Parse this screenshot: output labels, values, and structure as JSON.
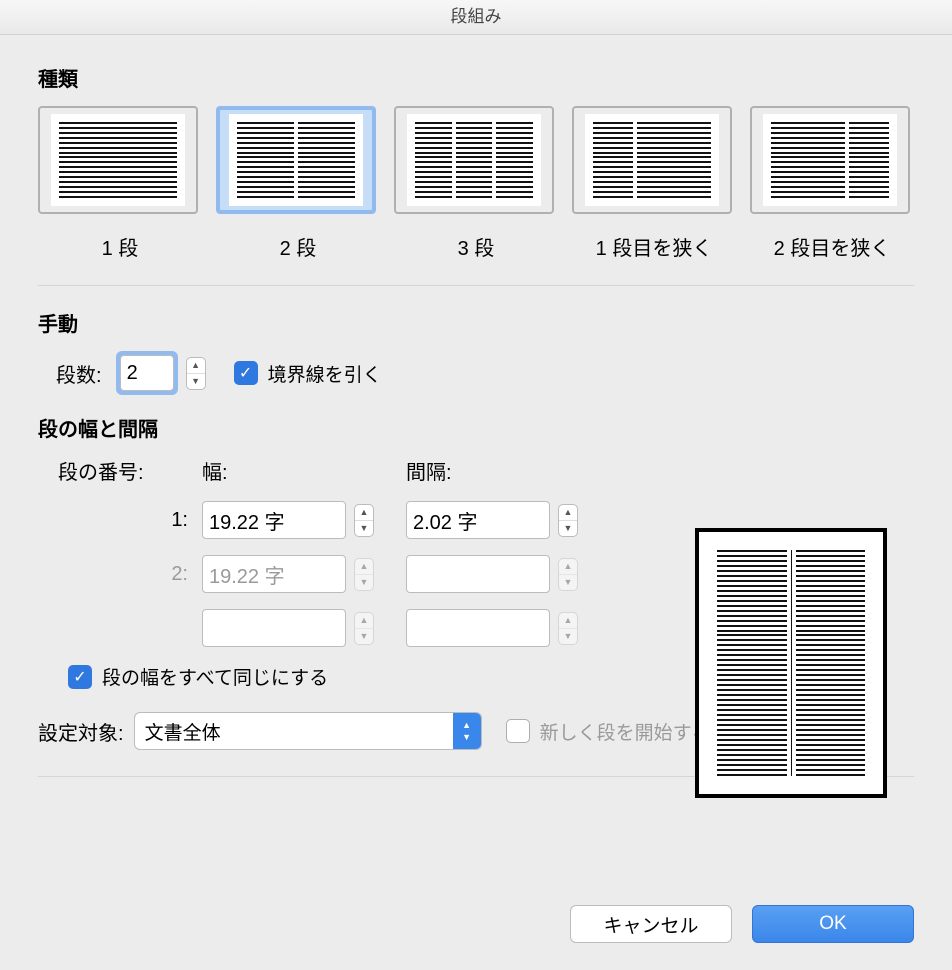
{
  "dialog_title": "段組み",
  "section_presets_heading": "種類",
  "presets": {
    "one": {
      "label": "1 段"
    },
    "two": {
      "label": "2 段",
      "selected": true
    },
    "three": {
      "label": "3 段"
    },
    "left": {
      "label": "1 段目を狭く"
    },
    "right": {
      "label": "2 段目を狭く"
    }
  },
  "section_manual_heading": "手動",
  "columns_label": "段数:",
  "columns_value": "2",
  "line_between_label": "境界線を引く",
  "line_between_checked": true,
  "width_spacing_heading": "段の幅と間隔",
  "ws_headers": {
    "index": "段の番号:",
    "width": "幅:",
    "gap": "間隔:"
  },
  "ws_rows": [
    {
      "idx": "1:",
      "width": "19.22 字",
      "gap": "2.02 字",
      "enabled": true
    },
    {
      "idx": "2:",
      "width": "19.22 字",
      "gap": "",
      "enabled": false
    },
    {
      "idx": "",
      "width": "",
      "gap": "",
      "enabled": false
    }
  ],
  "equal_width_label": "段の幅をすべて同じにする",
  "equal_width_checked": true,
  "apply_to_label": "設定対象:",
  "apply_to_value": "文書全体",
  "start_new_column_label": "新しく段を開始する",
  "start_new_column_enabled": false,
  "buttons": {
    "cancel": "キャンセル",
    "ok": "OK"
  }
}
